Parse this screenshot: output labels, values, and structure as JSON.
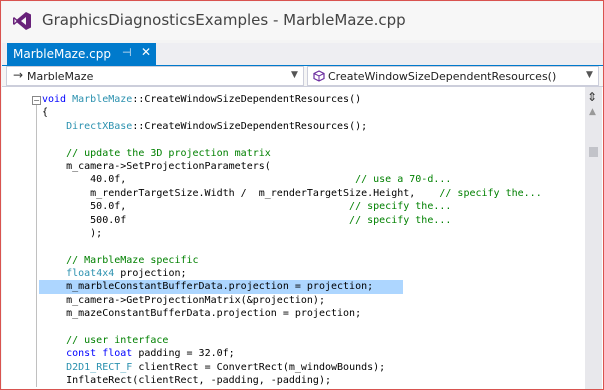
{
  "window": {
    "title": "GraphicsDiagnosticsExamples - MarbleMaze.cpp"
  },
  "tab": {
    "label": "MarbleMaze.cpp",
    "pin": "⊣",
    "close": "✕"
  },
  "navigation": {
    "scope": "MarbleMaze",
    "member": "CreateWindowSizeDependentResources()"
  },
  "code_lines": [
    [
      {
        "t": "void ",
        "c": "kw"
      },
      {
        "t": "MarbleMaze",
        "c": "ty"
      },
      {
        "t": "::CreateWindowSizeDependentResources()",
        "c": ""
      }
    ],
    [
      {
        "t": "{",
        "c": ""
      }
    ],
    [
      {
        "t": "    ",
        "c": ""
      },
      {
        "t": "DirectXBase",
        "c": "ty"
      },
      {
        "t": "::CreateWindowSizeDependentResources();",
        "c": ""
      }
    ],
    [
      {
        "t": "",
        "c": ""
      }
    ],
    [
      {
        "t": "    // update the 3D projection matrix",
        "c": "cm"
      }
    ],
    [
      {
        "t": "    m_camera->SetProjectionParameters(",
        "c": ""
      }
    ],
    [
      {
        "t": "        40.0f,                                      ",
        "c": ""
      },
      {
        "t": "// use a 70-d...",
        "c": "cm"
      }
    ],
    [
      {
        "t": "        m_renderTargetSize.Width /  m_renderTargetSize.Height,    ",
        "c": ""
      },
      {
        "t": "// specify the...",
        "c": "cm"
      }
    ],
    [
      {
        "t": "        50.0f,                                     ",
        "c": ""
      },
      {
        "t": "// specify the...",
        "c": "cm"
      }
    ],
    [
      {
        "t": "        500.0f                                     ",
        "c": ""
      },
      {
        "t": "// specify the...",
        "c": "cm"
      }
    ],
    [
      {
        "t": "        );",
        "c": ""
      }
    ],
    [
      {
        "t": "",
        "c": ""
      }
    ],
    [
      {
        "t": "    // MarbleMaze specific",
        "c": "cm"
      }
    ],
    [
      {
        "t": "    ",
        "c": ""
      },
      {
        "t": "float4x4",
        "c": "ty"
      },
      {
        "t": " projection;",
        "c": ""
      }
    ],
    [
      {
        "t": "    m_marbleConstantBufferData.projection = projection;",
        "c": "",
        "hl": true
      }
    ],
    [
      {
        "t": "    m_camera->GetProjectionMatrix(&projection);",
        "c": ""
      }
    ],
    [
      {
        "t": "    m_mazeConstantBufferData.projection = projection;",
        "c": ""
      }
    ],
    [
      {
        "t": "",
        "c": ""
      }
    ],
    [
      {
        "t": "    // user interface",
        "c": "cm"
      }
    ],
    [
      {
        "t": "    ",
        "c": ""
      },
      {
        "t": "const float",
        "c": "kw"
      },
      {
        "t": " padding = 32.0f;",
        "c": ""
      }
    ],
    [
      {
        "t": "    ",
        "c": ""
      },
      {
        "t": "D2D1_RECT_F",
        "c": "ty"
      },
      {
        "t": " clientRect = ConvertRect(m_windowBounds);",
        "c": ""
      }
    ],
    [
      {
        "t": "    InflateRect(clientRect, -padding, -padding);",
        "c": ""
      }
    ]
  ],
  "icons": {
    "logo": "visual-studio-logo",
    "nav_scope_arrow": "→",
    "dropdown": "▼",
    "collapse": "−",
    "split": "⇕",
    "scroll_up": "▲"
  },
  "colors": {
    "accent": "#007acc",
    "keyword": "#0000ff",
    "comment": "#008000",
    "type": "#2b91af",
    "highlight": "#add6ff"
  }
}
